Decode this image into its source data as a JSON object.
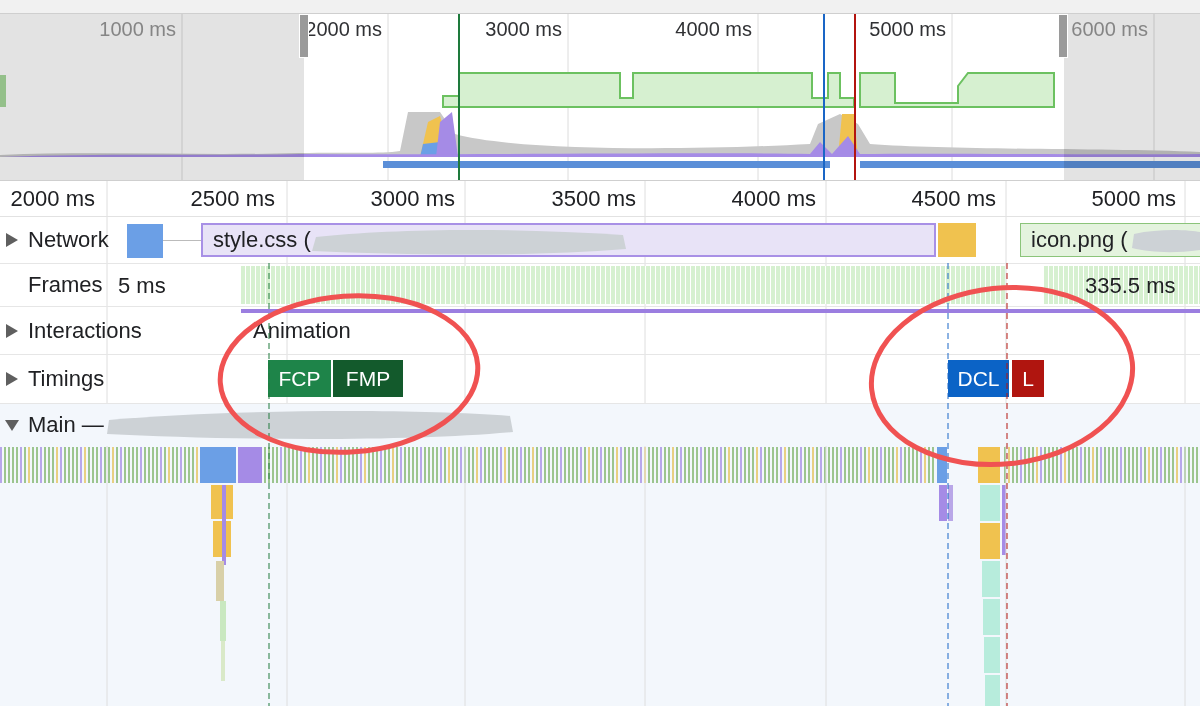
{
  "overview": {
    "ticks": [
      {
        "label": "1000 ms",
        "dimmed": true
      },
      {
        "label": "2000 ms",
        "dimmed": false
      },
      {
        "label": "3000 ms",
        "dimmed": false
      },
      {
        "label": "4000 ms",
        "dimmed": false
      },
      {
        "label": "5000 ms",
        "dimmed": false
      },
      {
        "label": "6000 ms",
        "dimmed": true
      }
    ]
  },
  "ruler": {
    "ticks": [
      "2000 ms",
      "2500 ms",
      "3000 ms",
      "3500 ms",
      "4000 ms",
      "4500 ms",
      "5000 ms"
    ]
  },
  "tracks": [
    {
      "kind": "network",
      "label": "Network",
      "expanded": false,
      "requests": [
        {
          "name": "style.css (",
          "color": "#e8e3f7"
        },
        {
          "name": "icon.png (",
          "color": "#e4f3de"
        }
      ]
    },
    {
      "kind": "frames",
      "label": "Frames",
      "durations": [
        "5 ms",
        "335.5 ms"
      ]
    },
    {
      "kind": "interactions",
      "label": "Interactions",
      "expanded": false,
      "events": [
        "Animation"
      ]
    },
    {
      "kind": "timings",
      "label": "Timings",
      "expanded": false,
      "markers": [
        {
          "label": "FCP",
          "color": "#1e8449"
        },
        {
          "label": "FMP",
          "color": "#135a2c"
        },
        {
          "label": "DCL",
          "color": "#0b63c6"
        },
        {
          "label": "L",
          "color": "#b0150f"
        }
      ]
    },
    {
      "kind": "main",
      "label": "Main —",
      "expanded": true
    }
  ]
}
